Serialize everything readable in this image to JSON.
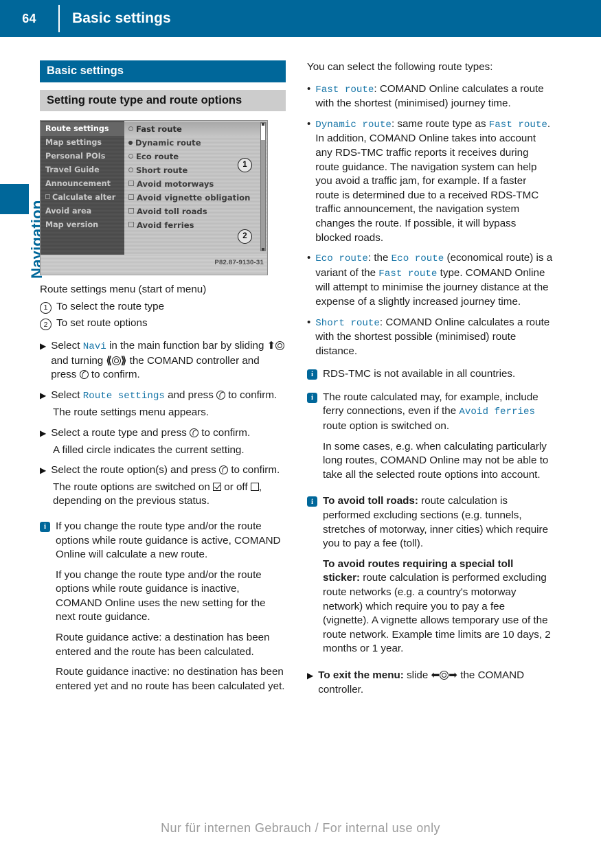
{
  "header": {
    "page_number": "64",
    "title": "Basic settings"
  },
  "sidebar": {
    "chapter_label": "Navigation"
  },
  "left_column": {
    "section_title": "Basic settings",
    "subsection_title": "Setting route type and route options",
    "screenshot": {
      "menu_items": [
        {
          "label": "Route settings",
          "selected": true,
          "checkbox": false
        },
        {
          "label": "Map settings",
          "selected": false,
          "checkbox": false
        },
        {
          "label": "Personal POIs",
          "selected": false,
          "checkbox": false
        },
        {
          "label": "Travel Guide",
          "selected": false,
          "checkbox": false
        },
        {
          "label": "Announcement",
          "selected": false,
          "checkbox": false
        },
        {
          "label": "Calculate alter",
          "selected": false,
          "checkbox": true
        },
        {
          "label": "Avoid area",
          "selected": false,
          "checkbox": false
        },
        {
          "label": "Map version",
          "selected": false,
          "checkbox": false
        }
      ],
      "options": [
        {
          "label": "Fast route",
          "mark": "radio-off",
          "highlighted": true
        },
        {
          "label": "Dynamic route",
          "mark": "radio-on",
          "highlighted": false
        },
        {
          "label": "Eco route",
          "mark": "radio-off",
          "highlighted": false
        },
        {
          "label": "Short route",
          "mark": "radio-off",
          "highlighted": false
        },
        {
          "label": "Avoid motorways",
          "mark": "check-off",
          "highlighted": false
        },
        {
          "label": "Avoid vignette obligation",
          "mark": "check-off",
          "highlighted": false
        },
        {
          "label": "Avoid toll roads",
          "mark": "check-off",
          "highlighted": false
        },
        {
          "label": "Avoid ferries",
          "mark": "check-off",
          "highlighted": false
        }
      ],
      "callout_1": "1",
      "callout_2": "2",
      "image_code": "P82.87-9130-31"
    },
    "caption": "Route settings menu (start of menu)",
    "legend": [
      {
        "number": "1",
        "text": "To select the route type"
      },
      {
        "number": "2",
        "text": "To set route options"
      }
    ],
    "steps": {
      "step1_a": "Select",
      "step1_navi": "Navi",
      "step1_b": "in the main function bar by sliding",
      "step1_c": "and turning",
      "step1_d": "the COMAND controller and press",
      "step1_e": "to confirm.",
      "step2_a": "Select",
      "step2_ui": "Route settings",
      "step2_b": "and press",
      "step2_c": "to confirm.",
      "step2_result": "The route settings menu appears.",
      "step3_a": "Select a route type and press",
      "step3_b": "to confirm.",
      "step3_result": "A filled circle indicates the current setting.",
      "step4_a": "Select the route option(s) and press",
      "step4_b": "to confirm.",
      "step4_result_a": "The route options are switched on",
      "step4_result_b": "or off",
      "step4_result_c": ", depending on the previous status."
    },
    "note": {
      "para1": "If you change the route type and/or the route options while route guidance is active, COMAND Online will calculate a new route.",
      "para2": "If you change the route type and/or the route options while route guidance is inactive, COMAND Online uses the new setting for the next route guidance.",
      "para3": "Route guidance active: a destination has been entered and the route has been calculated.",
      "para4": "Route guidance inactive: no destination has been entered yet and no route has been calculated yet."
    }
  },
  "right_column": {
    "intro": "You can select the following route types:",
    "route_types": [
      {
        "name": "Fast route",
        "body": ": COMAND Online calculates a route with the shortest (minimised) journey time."
      },
      {
        "name": "Dynamic route",
        "body_a": ": same route type as ",
        "ref": "Fast route",
        "body_b": ". In addition, COMAND Online takes into account any RDS-TMC traffic reports it receives during route guidance. The navigation system can help you avoid a traffic jam, for example. If a faster route is determined due to a received RDS-TMC traffic announcement, the navigation system changes the route. If possible, it will bypass blocked roads."
      },
      {
        "name": "Eco route",
        "body_a": ": the ",
        "ref1": "Eco route",
        "body_b": " (economical route) is a variant of the ",
        "ref2": "Fast route",
        "body_c": " type. COMAND Online will attempt to minimise the journey distance at the expense of a slightly increased journey time."
      },
      {
        "name": "Short route",
        "body": ": COMAND Online calculates a route with the shortest possible (minimised) route distance."
      }
    ],
    "notes": [
      {
        "text": "RDS-TMC is not available in all countries."
      }
    ],
    "note_ferries": {
      "para1_a": "The route calculated may, for example, include ferry connections, even if the ",
      "para1_ui": "Avoid ferries",
      "para1_b": " route option is switched on.",
      "para2": "In some cases, e.g. when calculating particularly long routes, COMAND Online may not be able to take all the selected route options into account."
    },
    "note_toll": {
      "heading1": "To avoid toll roads:",
      "para1": " route calculation is performed excluding sections (e.g. tunnels, stretches of motorway, inner cities) which require you to pay a fee (toll).",
      "heading2": "To avoid routes requiring a special toll sticker:",
      "para2": " route calculation is performed excluding route networks (e.g. a country's motorway network) which require you to pay a fee (vignette). A vignette allows temporary use of the route network. Example time limits are 10 days, 2 months or 1 year."
    },
    "exit_step": {
      "heading": "To exit the menu:",
      "text_a": " slide",
      "text_b": "the COMAND controller."
    }
  },
  "footer": {
    "watermark": "Nur für internen Gebrauch / For internal use only"
  }
}
